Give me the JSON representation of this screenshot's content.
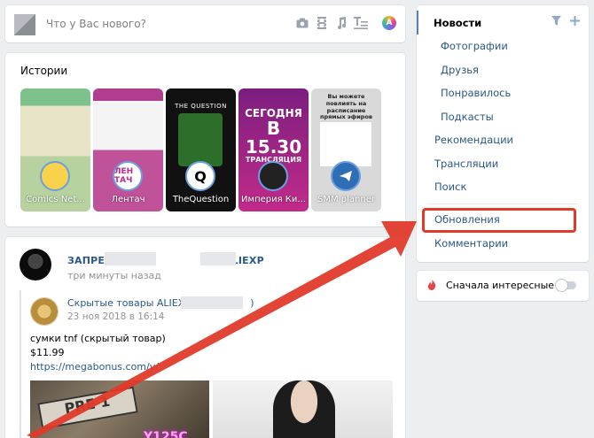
{
  "composer": {
    "placeholder": "Что у Вас нового?",
    "tools": [
      "camera-icon",
      "video-icon",
      "music-icon",
      "text-format-icon",
      "color-palette-icon"
    ]
  },
  "stories": {
    "title": "Истории",
    "items": [
      {
        "label": "Comics Net..."
      },
      {
        "label": "Лентач",
        "ring_text": "ЛЕН ТАЧ"
      },
      {
        "label": "TheQuestion",
        "top_text": "THE QUESTION",
        "ring_text": "Q"
      },
      {
        "label": "Империя Ки...",
        "big1": "СЕГОДНЯ",
        "big2": "В 15.30",
        "big3": "ТРАНСЛЯЦИЯ"
      },
      {
        "label": "SMM planner",
        "top_text": "Вы можете повлиять на расписание прямых эфиров"
      }
    ]
  },
  "post": {
    "author": "ЗАПРЕЩ... ALIEXP...",
    "author_visible": "ЗАПРЕЩ",
    "author_visible_2": "ALIEXP",
    "time": "три минуты назад",
    "repost": {
      "author": "Скрытые товары ALIEX",
      "author_tail": ")",
      "time": "23 ноя 2018 в 16:14"
    },
    "text_line1": "сумки tnf (скрытый товар)",
    "text_line2": "$11.99",
    "link": "https://megabonus.com/y/",
    "image1_text": "Y125C",
    "plate_text": "PRE 1"
  },
  "menu": {
    "items": [
      {
        "label": "Новости",
        "active": true,
        "sub": false
      },
      {
        "label": "Фотографии",
        "active": false,
        "sub": true
      },
      {
        "label": "Друзья",
        "active": false,
        "sub": true
      },
      {
        "label": "Понравилось",
        "active": false,
        "sub": true
      },
      {
        "label": "Подкасты",
        "active": false,
        "sub": true
      },
      {
        "label": "Рекомендации",
        "active": false,
        "sub": false
      },
      {
        "label": "Трансляции",
        "active": false,
        "sub": false
      },
      {
        "label": "Поиск",
        "active": false,
        "sub": false
      },
      {
        "label": "Обновления",
        "active": false,
        "sub": false
      },
      {
        "label": "Комментарии",
        "active": false,
        "sub": false
      }
    ],
    "icons": [
      "filter-icon",
      "add-icon"
    ]
  },
  "interesting": {
    "label": "Сначала интересные",
    "enabled": false
  },
  "annotation": {
    "color": "#e03a2a",
    "highlighted": "Обновления"
  },
  "colors": {
    "link": "#2a5885",
    "accent": "#5181b8",
    "background": "#edeef0"
  }
}
